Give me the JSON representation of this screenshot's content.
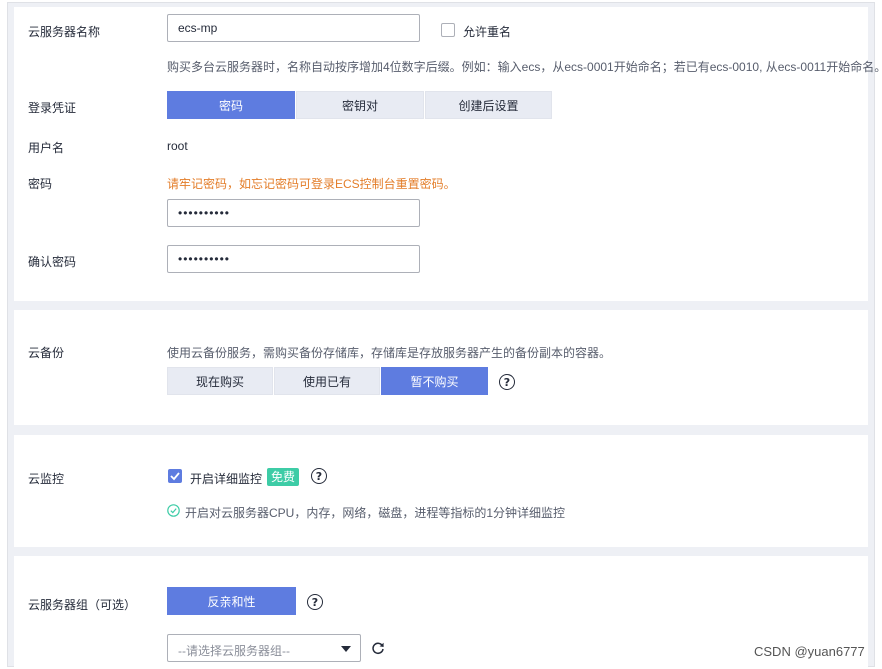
{
  "server_name": {
    "label": "云服务器名称",
    "value": "ecs-mp",
    "allow_duplicate_label": "允许重名",
    "hint": "购买多台云服务器时，名称自动按序增加4位数字后缀。例如：输入ecs，从ecs-0001开始命名；若已有ecs-0010, 从ecs-0011开始命名。"
  },
  "login": {
    "label": "登录凭证",
    "options": [
      "密码",
      "密钥对",
      "创建后设置"
    ],
    "selected": "密码"
  },
  "username": {
    "label": "用户名",
    "value": "root"
  },
  "password": {
    "label": "密码",
    "warning": "请牢记密码，如忘记密码可登录ECS控制台重置密码。",
    "value": "••••••••••"
  },
  "confirm_password": {
    "label": "确认密码",
    "value": "••••••••••"
  },
  "backup": {
    "label": "云备份",
    "hint": "使用云备份服务，需购买备份存储库，存储库是存放服务器产生的备份副本的容器。",
    "options": [
      "现在购买",
      "使用已有",
      "暂不购买"
    ],
    "selected": "暂不购买",
    "help_glyph": "?"
  },
  "monitor": {
    "label": "云监控",
    "checkbox_label": "开启详细监控",
    "badge": "免费",
    "help_glyph": "?",
    "note": "开启对云服务器CPU，内存，网络，磁盘，进程等指标的1分钟详细监控"
  },
  "server_group": {
    "label": "云服务器组（可选）",
    "button": "反亲和性",
    "help_glyph": "?",
    "select_placeholder": "--请选择云服务器组--"
  },
  "watermark": "CSDN @yuan6777",
  "colors": {
    "primary": "#5e7ce0",
    "warning": "#e37d29",
    "success": "#3dcca6",
    "segment_bg": "#e8ebf3",
    "section_gap": "#eef0f5"
  }
}
